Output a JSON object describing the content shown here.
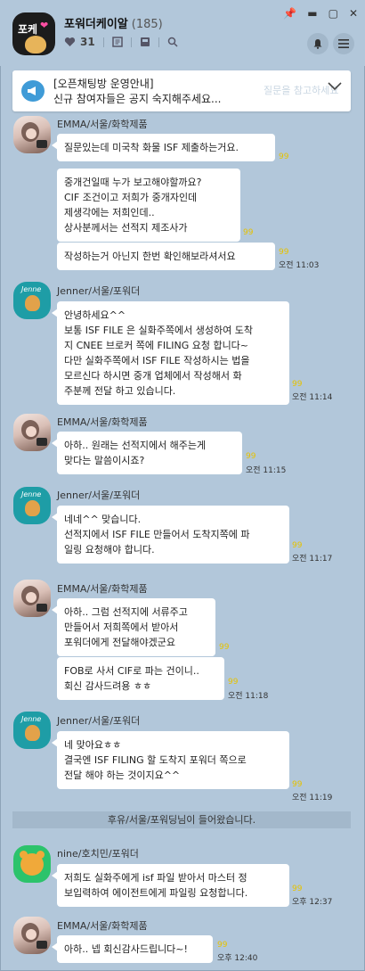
{
  "window": {
    "title": "포워더케이알",
    "member_count": "(185)",
    "like_count": "31"
  },
  "room_avatar": {
    "text": "포케"
  },
  "notice": {
    "title": "[오픈채팅방 운영안내]",
    "text": "신규 참여자들은 공지 숙지해주세요...",
    "ghost": "질문을 참고하세요"
  },
  "messages": [
    {
      "sender": "EMMA/서울/화학제품",
      "bubbles": [
        {
          "text": "질문있는데 미국착 화물 ISF 제출하는거요.",
          "unread": "99"
        },
        {
          "text": "중개건일때 누가 보고해야할까요?\nCIF 조건이고 저희가 중개자인데\n제생각에는 저희인데..\n상사분께서는 선적지 제조사가",
          "unread": "99"
        },
        {
          "text": "작성하는거 아닌지 한번 확인해보라셔서요",
          "unread": "99",
          "time": "오전 11:03"
        }
      ]
    },
    {
      "sender": "Jenner/서울/포워더",
      "bubbles": [
        {
          "text": "안녕하세요^^\n보통 ISF FILE 은 실화주쪽에서 생성하여 도착\n지 CNEE 브로커 쪽에 FILING 요청 합니다~\n다만 실화주쪽에서 ISF FILE 작성하시는 법을\n모르신다 하시면 중개 업체에서 작성해서 화\n주분께 전달 하고 있습니다.",
          "unread": "99",
          "time": "오전 11:14"
        }
      ]
    },
    {
      "sender": "EMMA/서울/화학제품",
      "bubbles": [
        {
          "text": "아하.. 원래는 선적지에서 해주는게\n맞다는 말씀이시죠?",
          "unread": "99",
          "time": "오전 11:15"
        }
      ]
    },
    {
      "sender": "Jenner/서울/포워더",
      "bubbles": [
        {
          "text": "네네^^ 맞습니다.\n선적지에서 ISF FILE 만들어서 도착지쪽에 파\n일링 요청해야 합니다.",
          "unread": "99",
          "time": "오전 11:17"
        }
      ]
    },
    {
      "sender": "EMMA/서울/화학제품",
      "bubbles": [
        {
          "text": "아하.. 그럼 선적지에 서류주고\n만들어서 저희쪽에서 받아서\n포워더에게 전달해야겠군요",
          "unread": "99"
        },
        {
          "text": "FOB로 사서 CIF로 파는 건이니..\n회신 감사드려용 ㅎㅎ",
          "unread": "99",
          "time": "오전 11:18"
        }
      ]
    },
    {
      "sender": "Jenner/서울/포워더",
      "bubbles": [
        {
          "text": "네 맞아요ㅎㅎ\n결국엔 ISF FILING 할 도착지 포워더 쪽으로\n전달 해야 하는 것이지요^^",
          "unread": "99",
          "time": "오전 11:19"
        }
      ]
    },
    {
      "system": "후유/서울/포워딩님이 들어왔습니다."
    },
    {
      "sender": "nine/호치민/포워더",
      "bubbles": [
        {
          "text": "저희도 실화주에게 isf 파일 받아서 마스터 정\n보입력하여 에이전트에게 파일링 요청합니다.",
          "unread": "99",
          "time": "오후 12:37"
        }
      ]
    },
    {
      "sender": "EMMA/서울/화학제품",
      "bubbles": [
        {
          "text": "아하.. 넵 회신감사드립니다~!",
          "unread": "99",
          "time": "오후 12:40"
        }
      ]
    }
  ]
}
